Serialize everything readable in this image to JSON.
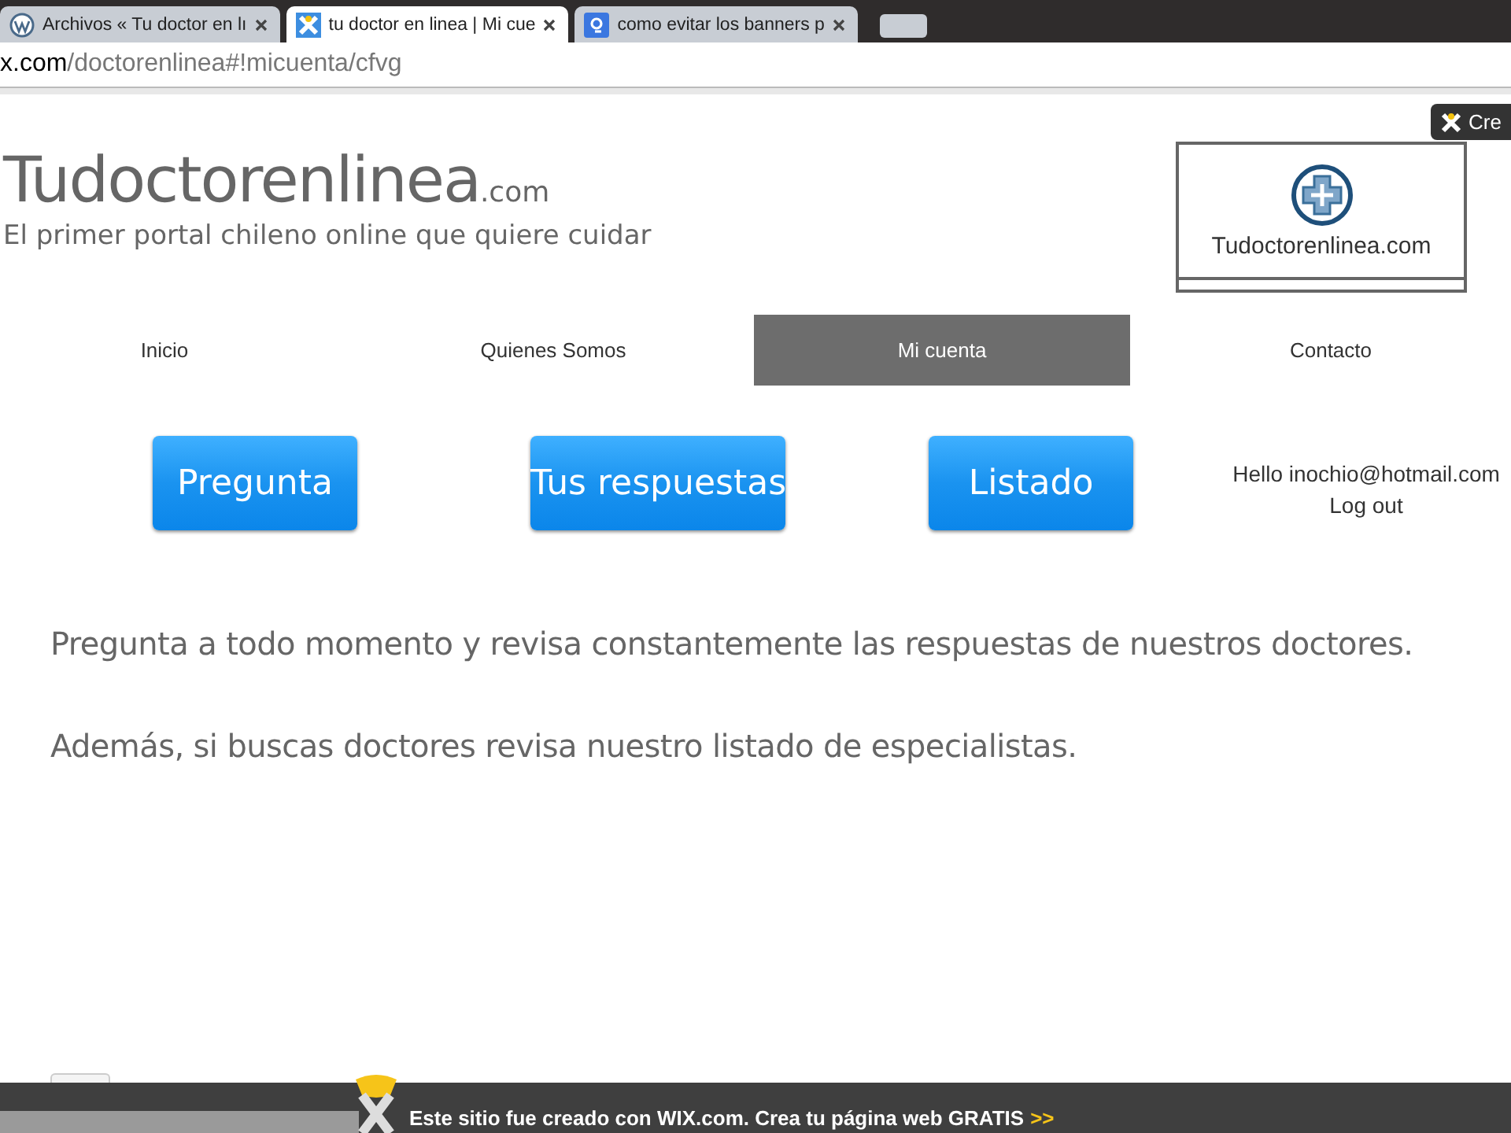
{
  "browser": {
    "tabs": [
      {
        "title": "Archivos « Tu doctor en lı",
        "kind": "wordpress",
        "selected": false
      },
      {
        "title": "tu doctor en linea | Mi cue",
        "kind": "wix",
        "selected": true
      },
      {
        "title": "como evitar los banners p",
        "kind": "google",
        "selected": false
      }
    ],
    "address": {
      "host": "x.com",
      "path": "/doctorenlinea#!micuenta/cfvg"
    }
  },
  "wix_badge": {
    "label": "Cre"
  },
  "site": {
    "title": "Tudoctorenlinea",
    "title_suffix": ".com",
    "tagline": "El primer portal chileno online que quiere cuidar",
    "logo_text": "Tudoctorenlinea.com",
    "nav": [
      {
        "label": "Inicio",
        "selected": false
      },
      {
        "label": "Quienes Somos",
        "selected": false
      },
      {
        "label": "Mi cuenta",
        "selected": true
      },
      {
        "label": "Contacto",
        "selected": false
      }
    ],
    "actions": [
      "Pregunta",
      "Tus respuestas",
      "Listado"
    ],
    "user": {
      "greeting": "Hello inochio@hotmail.com",
      "logout": "Log out"
    },
    "paragraphs": [
      "Pregunta a todo momento y revisa constantemente las respuestas de nuestros doctores.",
      "Además, si buscas doctores revisa nuestro listado de especialistas."
    ]
  },
  "footer_banner": {
    "text": "Este sitio fue creado con WIX.com. Crea tu página web GRATIS",
    "link": ">>"
  }
}
